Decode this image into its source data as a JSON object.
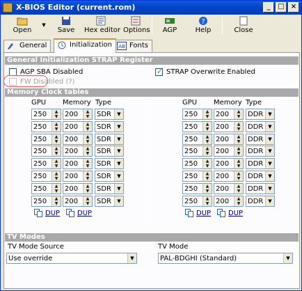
{
  "window": {
    "title": "X-BIOS Editor (current.rom)"
  },
  "toolbar": {
    "open": "Open",
    "save": "Save",
    "hex_editor": "Hex editor",
    "options": "Options",
    "agp": "AGP",
    "help": "Help",
    "close": "Close"
  },
  "tabs": [
    "General",
    "Initialization",
    "Fonts"
  ],
  "strap": {
    "header": "General Initialization STRAP Register",
    "agp_sba_disabled": "AGP SBA Disabled",
    "fw_disabled": "FW Disabled (?)",
    "strap_overwrite": "STRAP Overwrite Enabled"
  },
  "memory": {
    "header": "Memory Clock tables",
    "col_gpu": "GPU",
    "col_memory": "Memory",
    "col_type": "Type",
    "left_rows": [
      {
        "gpu": "250",
        "mem": "200",
        "type": "SDR"
      },
      {
        "gpu": "250",
        "mem": "200",
        "type": "SDR"
      },
      {
        "gpu": "250",
        "mem": "200",
        "type": "SDR"
      },
      {
        "gpu": "250",
        "mem": "200",
        "type": "SDR"
      },
      {
        "gpu": "250",
        "mem": "200",
        "type": "SDR"
      },
      {
        "gpu": "250",
        "mem": "200",
        "type": "SDR"
      },
      {
        "gpu": "250",
        "mem": "200",
        "type": "SDR"
      },
      {
        "gpu": "250",
        "mem": "200",
        "type": "SDR"
      }
    ],
    "right_rows": [
      {
        "gpu": "250",
        "mem": "200",
        "type": "DDR"
      },
      {
        "gpu": "250",
        "mem": "200",
        "type": "DDR"
      },
      {
        "gpu": "250",
        "mem": "200",
        "type": "DDR"
      },
      {
        "gpu": "250",
        "mem": "200",
        "type": "DDR"
      },
      {
        "gpu": "250",
        "mem": "200",
        "type": "DDR"
      },
      {
        "gpu": "250",
        "mem": "200",
        "type": "DDR"
      },
      {
        "gpu": "250",
        "mem": "200",
        "type": "DDR"
      },
      {
        "gpu": "250",
        "mem": "200",
        "type": "DDR"
      }
    ],
    "dup": "DUP"
  },
  "tv": {
    "header": "TV Modes",
    "source_label": "TV Mode Source",
    "source_value": "Use override",
    "mode_label": "TV Mode",
    "mode_value": "PAL-BDGHI (Standard)"
  }
}
